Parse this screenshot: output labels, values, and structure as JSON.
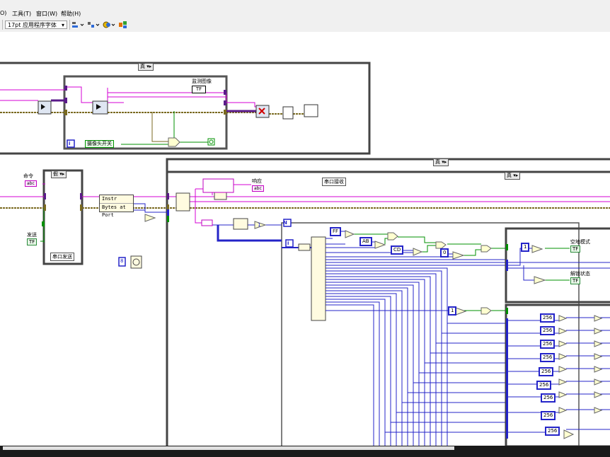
{
  "menu": {
    "items": [
      "O)",
      "工具(T)",
      "窗口(W)",
      "帮助(H)"
    ]
  },
  "toolbar": {
    "font_label": "17pt 应用程序字体",
    "font_arrow": "▾"
  },
  "diagram": {
    "case_top_selector": "真",
    "case_right_selector": "真",
    "case_inner_selector": "真",
    "case_left_selector": "假",
    "selector_arrow": "▾▸",
    "label_monitor_image": "监测图像",
    "label_monitor_tag": "TF",
    "label_camera_switch": "摄像头开关",
    "label_command": "命令",
    "label_command_tag": "abc",
    "label_send": "发送",
    "label_send_tag": "TF",
    "label_serial_send": "串口发送",
    "label_serial_recv": "串口接收",
    "label_response": "响应",
    "label_response_tag": "abc",
    "label_instr": "Instr",
    "label_bytes_at_port": "Bytes at Port",
    "label_loop_index": "i",
    "label_loop_n": "N",
    "const_ff": "FF",
    "const_ab": "AB",
    "const_cd": "CD",
    "const_zero": "0",
    "const_one_a": "1",
    "const_one_b": "1",
    "const_one_c": "1",
    "const_eight": "8",
    "label_air_ground": "空地模式",
    "label_unlock": "解锁状态",
    "bool_tag": "TF",
    "const_256": [
      "256",
      "256",
      "256",
      "256",
      "256",
      "256",
      "256",
      "256",
      "256"
    ]
  }
}
